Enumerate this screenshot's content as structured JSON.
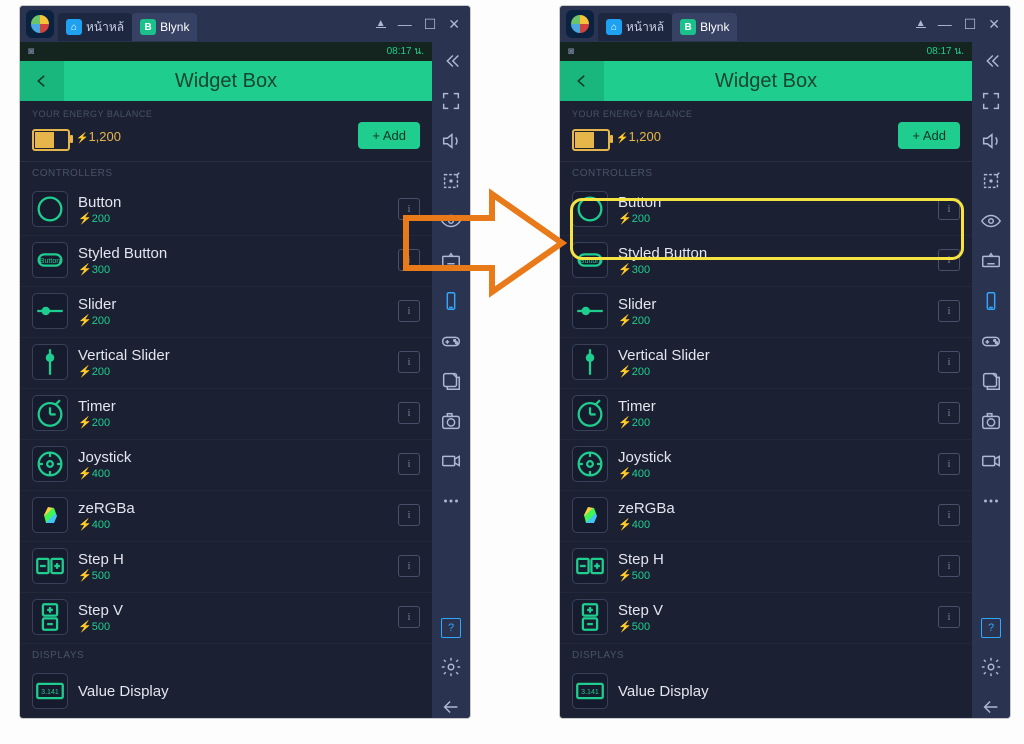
{
  "titlebar": {
    "tab_home": "หน้าหล้",
    "tab_active": "Blynk",
    "active_letter": "B"
  },
  "statusbar": {
    "time": "08:17 น."
  },
  "header": {
    "title": "Widget Box"
  },
  "energy": {
    "label": "YOUR ENERGY BALANCE",
    "value": "1,200",
    "add": "+ Add"
  },
  "sections": {
    "controllers": "CONTROLLERS",
    "displays": "DISPLAYS"
  },
  "controllers": [
    {
      "name": "Button",
      "cost": "200",
      "icon": "circle"
    },
    {
      "name": "Styled Button",
      "cost": "300",
      "icon": "styled"
    },
    {
      "name": "Slider",
      "cost": "200",
      "icon": "slider"
    },
    {
      "name": "Vertical Slider",
      "cost": "200",
      "icon": "vslider"
    },
    {
      "name": "Timer",
      "cost": "200",
      "icon": "timer"
    },
    {
      "name": "Joystick",
      "cost": "400",
      "icon": "joy"
    },
    {
      "name": "zeRGBa",
      "cost": "400",
      "icon": "zebra"
    },
    {
      "name": "Step H",
      "cost": "500",
      "icon": "steph"
    },
    {
      "name": "Step V",
      "cost": "500",
      "icon": "stepv"
    }
  ],
  "displays": [
    {
      "name": "Value Display",
      "cost": "",
      "icon": "value"
    }
  ],
  "rail": {
    "icons": [
      "collapse",
      "fullscreen",
      "volume",
      "location",
      "eye",
      "keyboard",
      "phone",
      "gamepad",
      "share",
      "camera",
      "record",
      "more"
    ],
    "bottom": [
      "help",
      "settings",
      "back"
    ]
  },
  "annotation": {
    "arrow_color": "#e87a1a",
    "highlight_color": "#f5e342",
    "highlight_target": "Button"
  }
}
